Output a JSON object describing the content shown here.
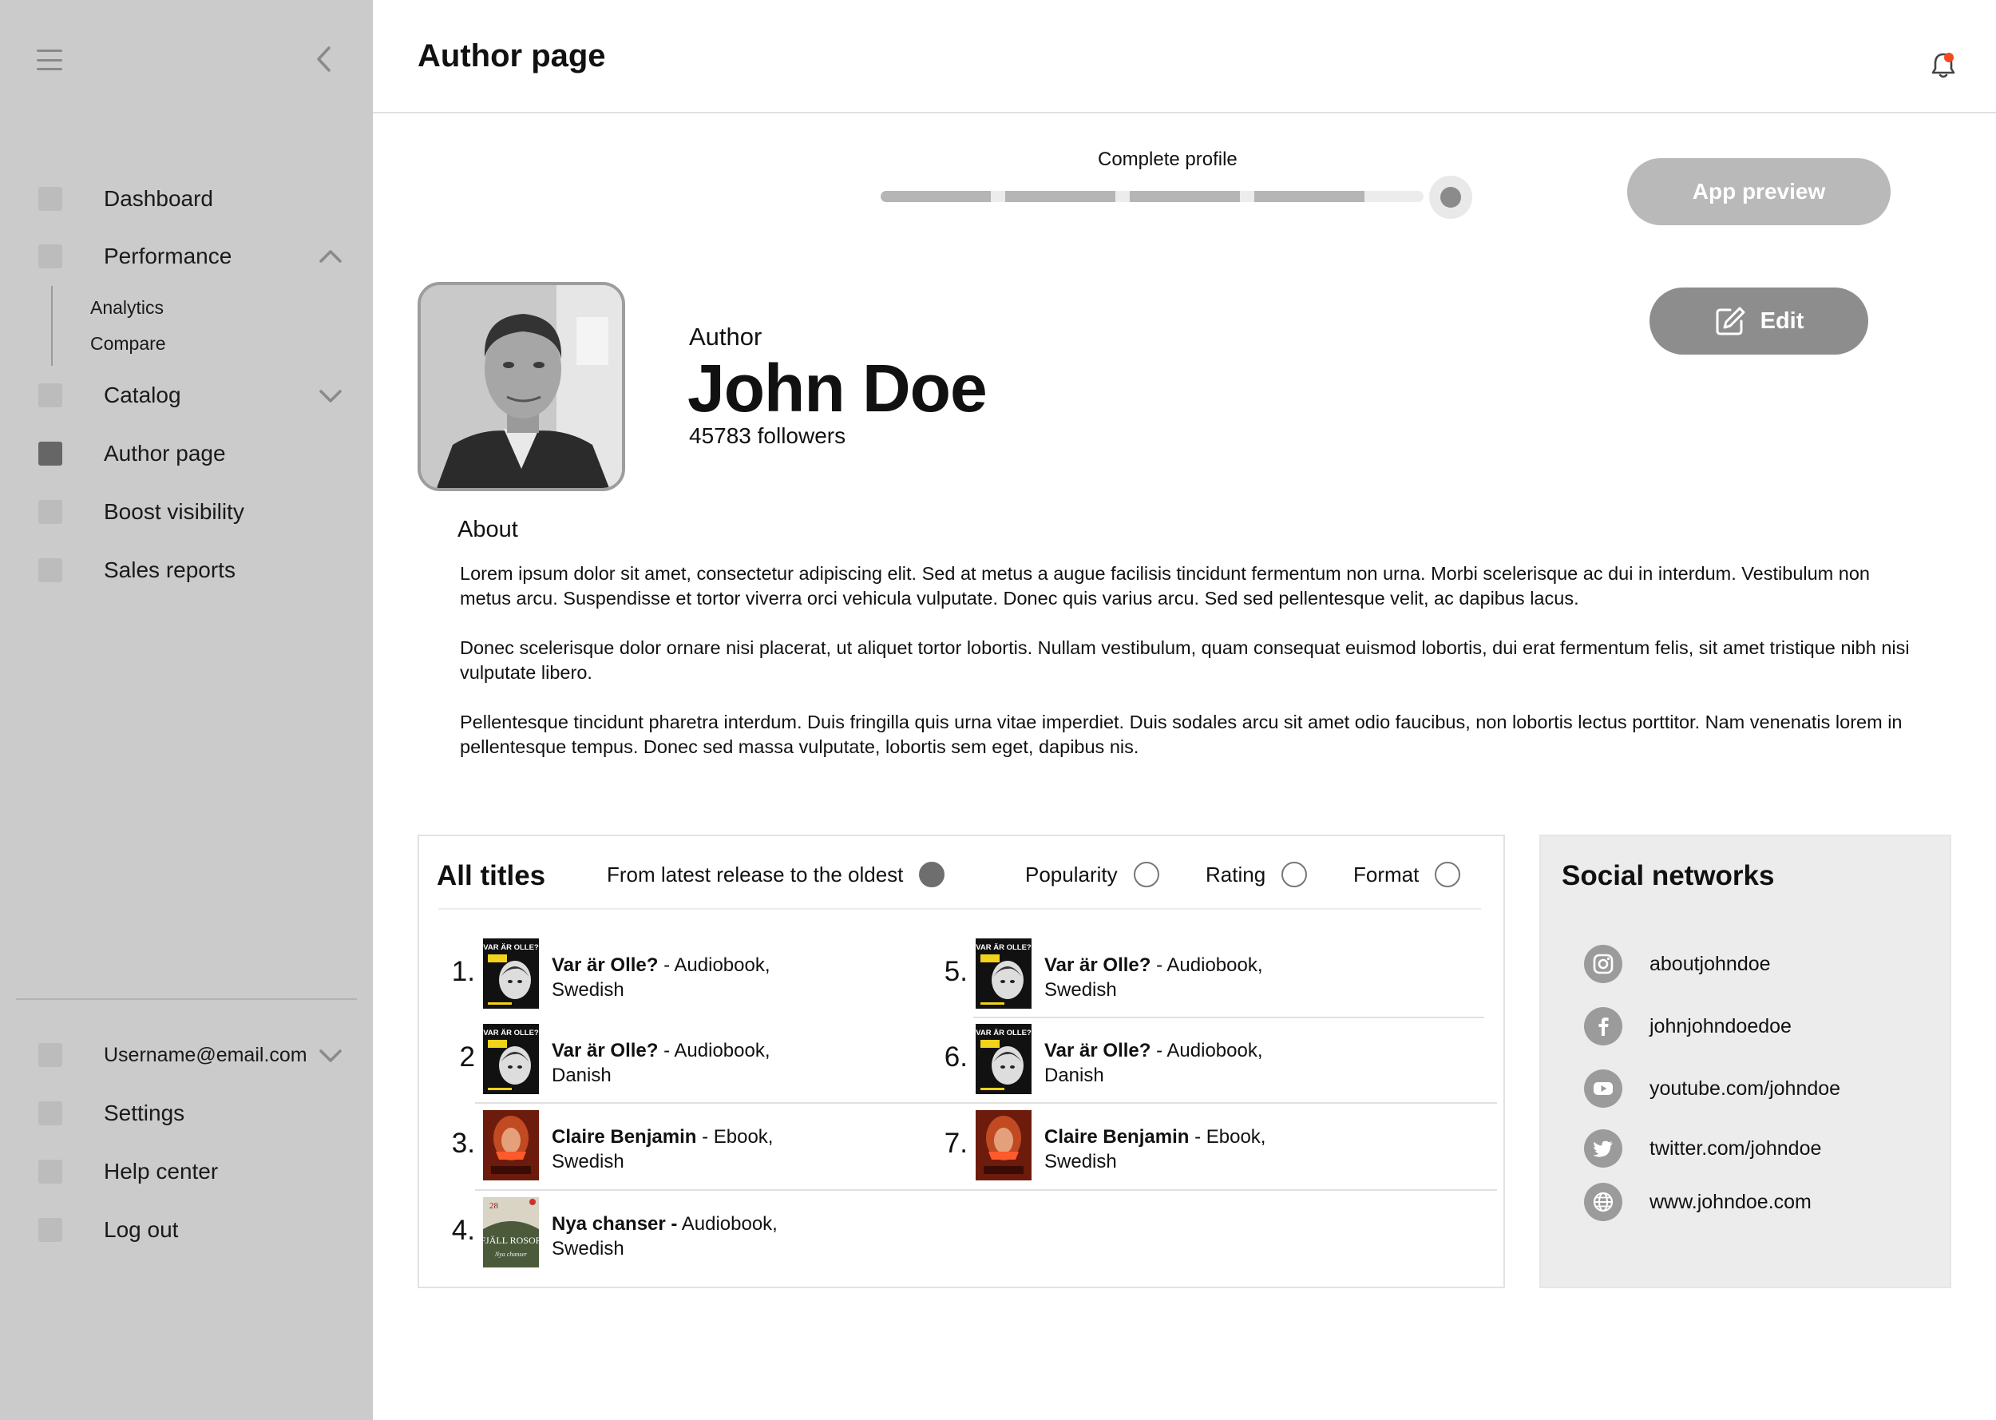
{
  "sidebar": {
    "nav": [
      {
        "label": "Dashboard"
      },
      {
        "label": "Performance"
      },
      {
        "label": "Catalog"
      },
      {
        "label": "Author page"
      },
      {
        "label": "Boost visibility"
      },
      {
        "label": "Sales reports"
      }
    ],
    "performance_sub": [
      "Analytics",
      "Compare"
    ],
    "account": {
      "username": "Username@email.com"
    },
    "bottom": [
      {
        "label": "Settings"
      },
      {
        "label": "Help center"
      },
      {
        "label": "Log out"
      }
    ],
    "active_item": "Author page"
  },
  "header": {
    "title": "Author page",
    "notification_dot_color": "#f04a1e"
  },
  "profile_progress": {
    "label": "Complete profile",
    "completed_fraction": 0.8,
    "segments_total": 5,
    "segments_done": 4
  },
  "buttons": {
    "app_preview": "App preview",
    "edit": "Edit"
  },
  "author": {
    "role": "Author",
    "name": "John Doe",
    "followers": "45783 followers"
  },
  "about": {
    "title": "About",
    "paragraphs": [
      "Lorem ipsum dolor sit amet, consectetur adipiscing elit. Sed at metus a augue facilisis tincidunt fermentum non urna. Morbi scelerisque ac dui in interdum. Vestibulum non metus arcu. Suspendisse et tortor viverra orci vehicula vulputate. Donec quis varius arcu. Sed sed pellentesque velit, ac dapibus lacus.",
      "Donec scelerisque dolor ornare nisi placerat, ut aliquet tortor lobortis. Nullam vestibulum, quam consequat euismod lobortis, dui erat fermentum felis, sit amet tristique nibh nisi vulputate libero.",
      "Pellentesque tincidunt pharetra interdum. Duis fringilla quis urna vitae imperdiet. Duis sodales arcu sit amet odio faucibus, non lobortis lectus porttitor. Nam venenatis lorem in pellentesque tempus. Donec sed massa vulputate, lobortis sem eget, dapibus nis."
    ]
  },
  "titles": {
    "heading": "All titles",
    "sort_options": [
      {
        "label": "From latest release to the oldest",
        "selected": true
      },
      {
        "label": "Popularity",
        "selected": false
      },
      {
        "label": "Rating",
        "selected": false
      },
      {
        "label": "Format",
        "selected": false
      }
    ],
    "items": [
      {
        "num": "1.",
        "name": "Var är Olle?",
        "detail": " - Audiobook, Swedish",
        "cover": "olle"
      },
      {
        "num": "2",
        "name": "Var är Olle?",
        "detail": " - Audiobook, Danish",
        "cover": "olle"
      },
      {
        "num": "3.",
        "name": "Claire Benjamin",
        "detail": " - Ebook, Swedish",
        "cover": "claire"
      },
      {
        "num": "4.",
        "name": "Nya chanser -",
        "detail": " Audiobook, Swedish",
        "cover": "rosor"
      },
      {
        "num": "5.",
        "name": "Var är Olle?",
        "detail": " - Audiobook, Swedish",
        "cover": "olle"
      },
      {
        "num": "6.",
        "name": "Var är Olle?",
        "detail": " - Audiobook, Danish",
        "cover": "olle"
      },
      {
        "num": "7.",
        "name": "Claire Benjamin",
        "detail": " - Ebook, Swedish",
        "cover": "claire"
      }
    ],
    "cover_texts": {
      "olle": "VAR ÄR OLLE?",
      "rosor_top": "28",
      "rosor_title": "FJÄLL ROSOR",
      "rosor_sub": "Nya chanser"
    }
  },
  "social": {
    "heading": "Social networks",
    "items": [
      {
        "icon": "instagram-icon",
        "label": "aboutjohndoe"
      },
      {
        "icon": "facebook-icon",
        "label": "johnjohndoedoe"
      },
      {
        "icon": "youtube-icon",
        "label": "youtube.com/johndoe"
      },
      {
        "icon": "twitter-icon",
        "label": "twitter.com/johndoe"
      },
      {
        "icon": "globe-icon",
        "label": "www.johndoe.com"
      }
    ]
  }
}
